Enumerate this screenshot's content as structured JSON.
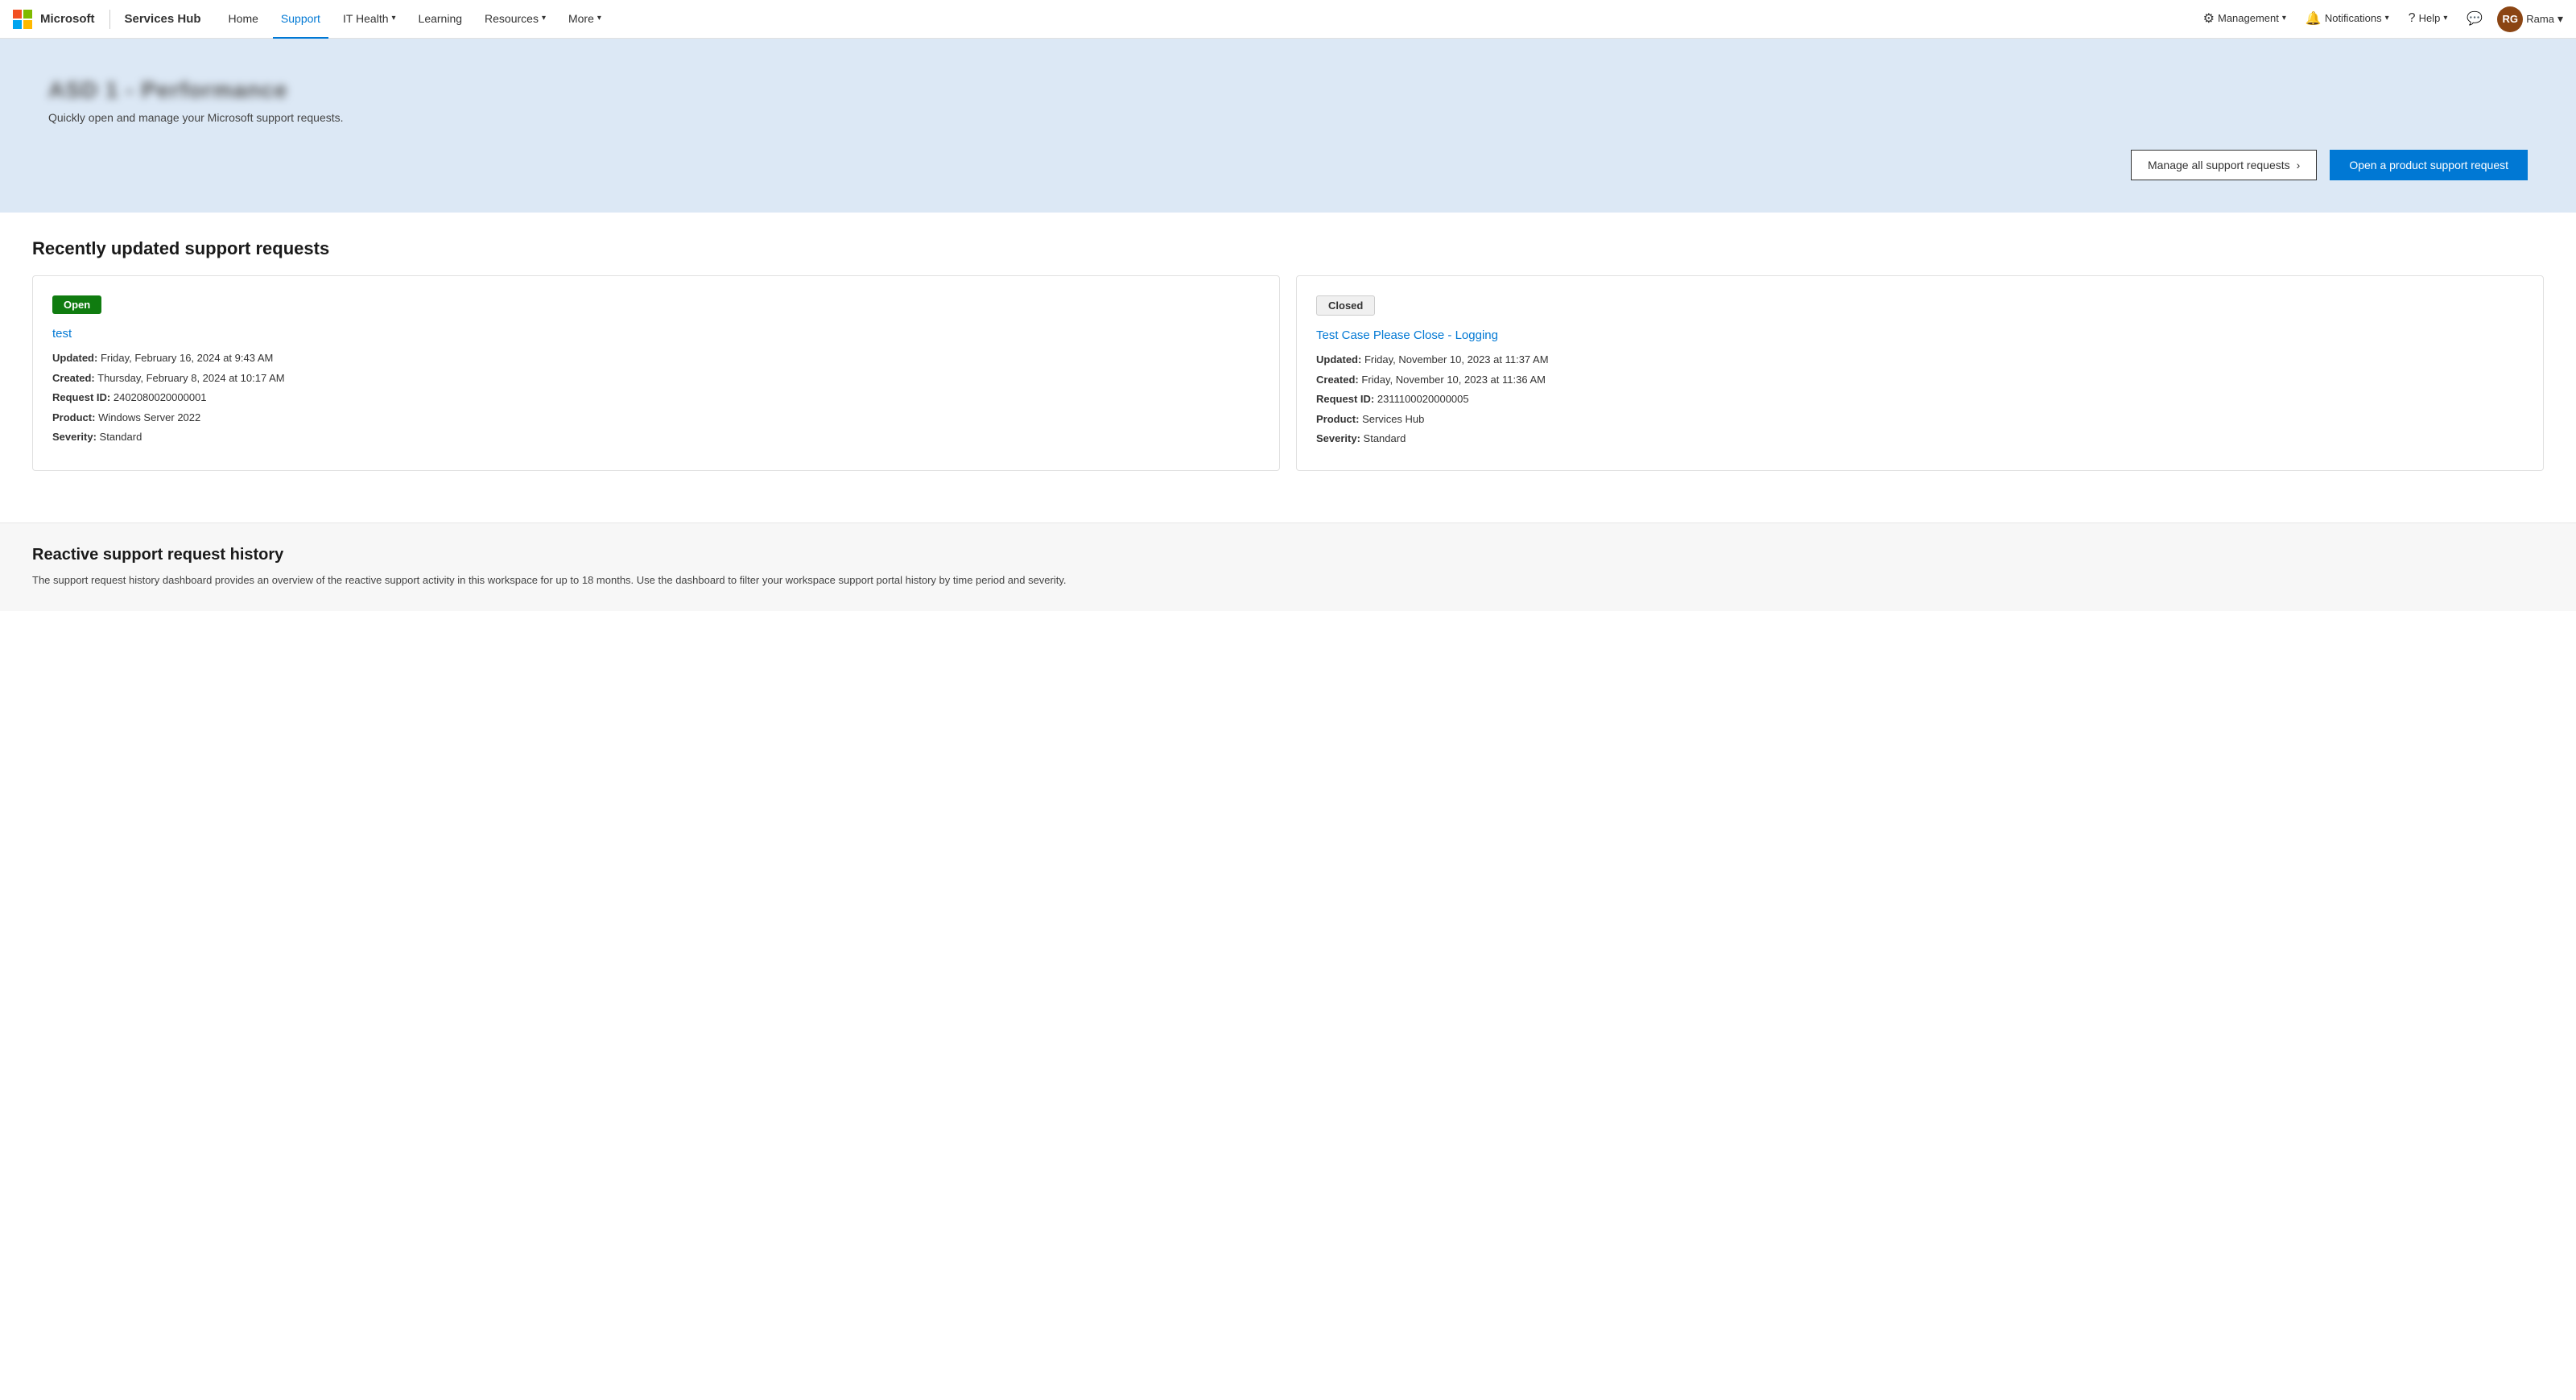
{
  "brand": {
    "ms_label": "Microsoft",
    "hub_name": "Services Hub"
  },
  "nav": {
    "home": "Home",
    "support": "Support",
    "it_health": "IT Health",
    "learning": "Learning",
    "resources": "Resources",
    "more": "More",
    "management": "Management",
    "notifications": "Notifications",
    "help": "Help",
    "user_initials": "RG",
    "user_name": "Rama"
  },
  "hero": {
    "title": "ASD 1 - Performance",
    "subtitle": "Quickly open and manage your Microsoft support requests.",
    "btn_manage": "Manage all support requests",
    "btn_open": "Open a product support request"
  },
  "recently_updated": {
    "section_title": "Recently updated support requests",
    "cards": [
      {
        "status": "Open",
        "status_class": "badge-open",
        "case_title": "test",
        "updated": "Friday, February 16, 2024 at 9:43 AM",
        "created": "Thursday, February 8, 2024 at 10:17 AM",
        "request_id": "2402080020000001",
        "product": "Windows Server 2022",
        "severity": "Standard"
      },
      {
        "status": "Closed",
        "status_class": "badge-closed",
        "case_title": "Test Case Please Close - Logging",
        "updated": "Friday, November 10, 2023 at 11:37 AM",
        "created": "Friday, November 10, 2023 at 11:36 AM",
        "request_id": "2311100020000005",
        "product": "Services Hub",
        "severity": "Standard"
      }
    ]
  },
  "history": {
    "title": "Reactive support request history",
    "description": "The support request history dashboard provides an overview of the reactive support activity in this workspace for up to 18 months. Use the dashboard to filter your workspace support portal history by time period and severity."
  },
  "labels": {
    "updated": "Updated:",
    "created": "Created:",
    "request_id": "Request ID:",
    "product": "Product:",
    "severity": "Severity:"
  }
}
